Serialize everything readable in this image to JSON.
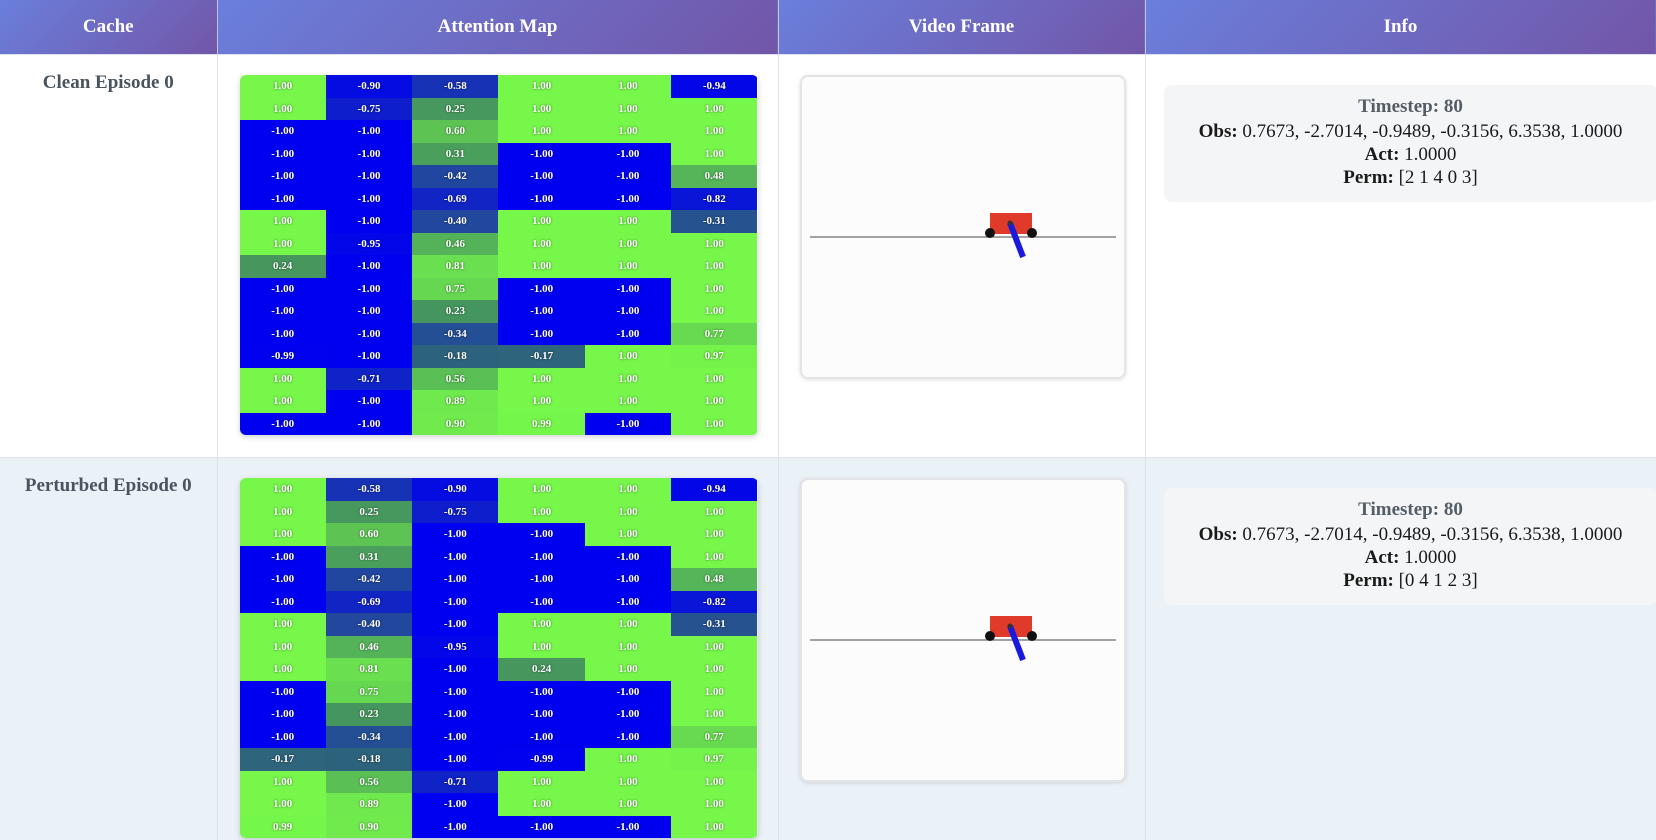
{
  "header": {
    "cache": "Cache",
    "attention_map": "Attention Map",
    "video_frame": "Video Frame",
    "info": "Info"
  },
  "colors": {
    "positive": "#76f74a",
    "negative": "#0000f0",
    "header_start": "#6a7fdc",
    "header_end": "#7256a8",
    "cart": "#e03a2a",
    "pole": "#1a1adc"
  },
  "rows": [
    {
      "cache_label": "Clean Episode 0",
      "attention": [
        [
          "1.00",
          "-0.90",
          "-0.58",
          "1.00",
          "1.00",
          "-0.94"
        ],
        [
          "1.00",
          "-0.75",
          "0.25",
          "1.00",
          "1.00",
          "1.00"
        ],
        [
          "-1.00",
          "-1.00",
          "0.60",
          "1.00",
          "1.00",
          "1.00"
        ],
        [
          "-1.00",
          "-1.00",
          "0.31",
          "-1.00",
          "-1.00",
          "1.00"
        ],
        [
          "-1.00",
          "-1.00",
          "-0.42",
          "-1.00",
          "-1.00",
          "0.48"
        ],
        [
          "-1.00",
          "-1.00",
          "-0.69",
          "-1.00",
          "-1.00",
          "-0.82"
        ],
        [
          "1.00",
          "-1.00",
          "-0.40",
          "1.00",
          "1.00",
          "-0.31"
        ],
        [
          "1.00",
          "-0.95",
          "0.46",
          "1.00",
          "1.00",
          "1.00"
        ],
        [
          "0.24",
          "-1.00",
          "0.81",
          "1.00",
          "1.00",
          "1.00"
        ],
        [
          "-1.00",
          "-1.00",
          "0.75",
          "-1.00",
          "-1.00",
          "1.00"
        ],
        [
          "-1.00",
          "-1.00",
          "0.23",
          "-1.00",
          "-1.00",
          "1.00"
        ],
        [
          "-1.00",
          "-1.00",
          "-0.34",
          "-1.00",
          "-1.00",
          "0.77"
        ],
        [
          "-0.99",
          "-1.00",
          "-0.18",
          "-0.17",
          "1.00",
          "0.97"
        ],
        [
          "1.00",
          "-0.71",
          "0.56",
          "1.00",
          "1.00",
          "1.00"
        ],
        [
          "1.00",
          "-1.00",
          "0.89",
          "1.00",
          "1.00",
          "1.00"
        ],
        [
          "-1.00",
          "-1.00",
          "0.90",
          "0.99",
          "-1.00",
          "1.00"
        ]
      ],
      "info": {
        "timestep_label": "Timestep:",
        "timestep": "80",
        "obs_label": "Obs:",
        "obs": "0.7673, -2.7014, -0.9489, -0.3156, 6.3538, 1.0000",
        "act_label": "Act:",
        "act": "1.0000",
        "perm_label": "Perm:",
        "perm": "[2 1 4 0 3]"
      }
    },
    {
      "cache_label": "Perturbed Episode 0",
      "attention": [
        [
          "1.00",
          "-0.58",
          "-0.90",
          "1.00",
          "1.00",
          "-0.94"
        ],
        [
          "1.00",
          "0.25",
          "-0.75",
          "1.00",
          "1.00",
          "1.00"
        ],
        [
          "1.00",
          "0.60",
          "-1.00",
          "-1.00",
          "1.00",
          "1.00"
        ],
        [
          "-1.00",
          "0.31",
          "-1.00",
          "-1.00",
          "-1.00",
          "1.00"
        ],
        [
          "-1.00",
          "-0.42",
          "-1.00",
          "-1.00",
          "-1.00",
          "0.48"
        ],
        [
          "-1.00",
          "-0.69",
          "-1.00",
          "-1.00",
          "-1.00",
          "-0.82"
        ],
        [
          "1.00",
          "-0.40",
          "-1.00",
          "1.00",
          "1.00",
          "-0.31"
        ],
        [
          "1.00",
          "0.46",
          "-0.95",
          "1.00",
          "1.00",
          "1.00"
        ],
        [
          "1.00",
          "0.81",
          "-1.00",
          "0.24",
          "1.00",
          "1.00"
        ],
        [
          "-1.00",
          "0.75",
          "-1.00",
          "-1.00",
          "-1.00",
          "1.00"
        ],
        [
          "-1.00",
          "0.23",
          "-1.00",
          "-1.00",
          "-1.00",
          "1.00"
        ],
        [
          "-1.00",
          "-0.34",
          "-1.00",
          "-1.00",
          "-1.00",
          "0.77"
        ],
        [
          "-0.17",
          "-0.18",
          "-1.00",
          "-0.99",
          "1.00",
          "0.97"
        ],
        [
          "1.00",
          "0.56",
          "-0.71",
          "1.00",
          "1.00",
          "1.00"
        ],
        [
          "1.00",
          "0.89",
          "-1.00",
          "1.00",
          "1.00",
          "1.00"
        ],
        [
          "0.99",
          "0.90",
          "-1.00",
          "-1.00",
          "-1.00",
          "1.00"
        ]
      ],
      "info": {
        "timestep_label": "Timestep:",
        "timestep": "80",
        "obs_label": "Obs:",
        "obs": "0.7673, -2.7014, -0.9489, -0.3156, 6.3538, 1.0000",
        "act_label": "Act:",
        "act": "1.0000",
        "perm_label": "Perm:",
        "perm": "[0 4 1 2 3]"
      }
    }
  ]
}
